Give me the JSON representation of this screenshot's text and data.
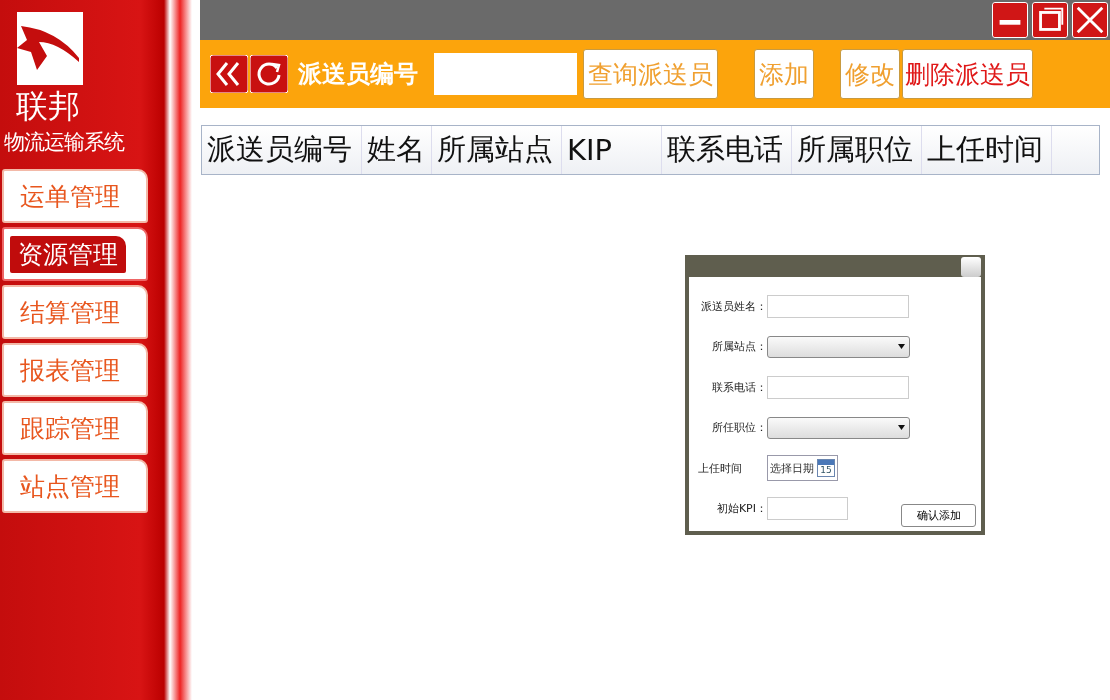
{
  "brand": {
    "name": "联邦",
    "subtitle": "物流运输系统"
  },
  "sidebar": {
    "items": [
      {
        "label": "运单管理",
        "selected": false
      },
      {
        "label": "资源管理",
        "selected": true
      },
      {
        "label": "结算管理",
        "selected": false
      },
      {
        "label": "报表管理",
        "selected": false
      },
      {
        "label": "跟踪管理",
        "selected": false
      },
      {
        "label": "站点管理",
        "selected": false
      }
    ]
  },
  "toolbar": {
    "label": "派送员编号",
    "search_button": "查询派送员",
    "buttons": [
      {
        "label": "添加",
        "kind": "normal"
      },
      {
        "label": "修改",
        "kind": "normal"
      },
      {
        "label": "删除派送员",
        "kind": "danger"
      }
    ]
  },
  "table": {
    "columns": [
      "派送员编号",
      "姓名",
      "所属站点",
      "KIP",
      "联系电话",
      "所属职位",
      "上任时间"
    ]
  },
  "dialog": {
    "fields": [
      {
        "label": "派送员姓名：",
        "kind": "text"
      },
      {
        "label": "所属站点：",
        "kind": "select"
      },
      {
        "label": "联系电话：",
        "kind": "text"
      },
      {
        "label": "所任职位：",
        "kind": "select"
      },
      {
        "label": "上任时间",
        "kind": "date",
        "placeholder": "选择日期",
        "calendar_day": "15"
      },
      {
        "label": "初始KPI：",
        "kind": "short"
      }
    ],
    "submit": "确认添加"
  }
}
